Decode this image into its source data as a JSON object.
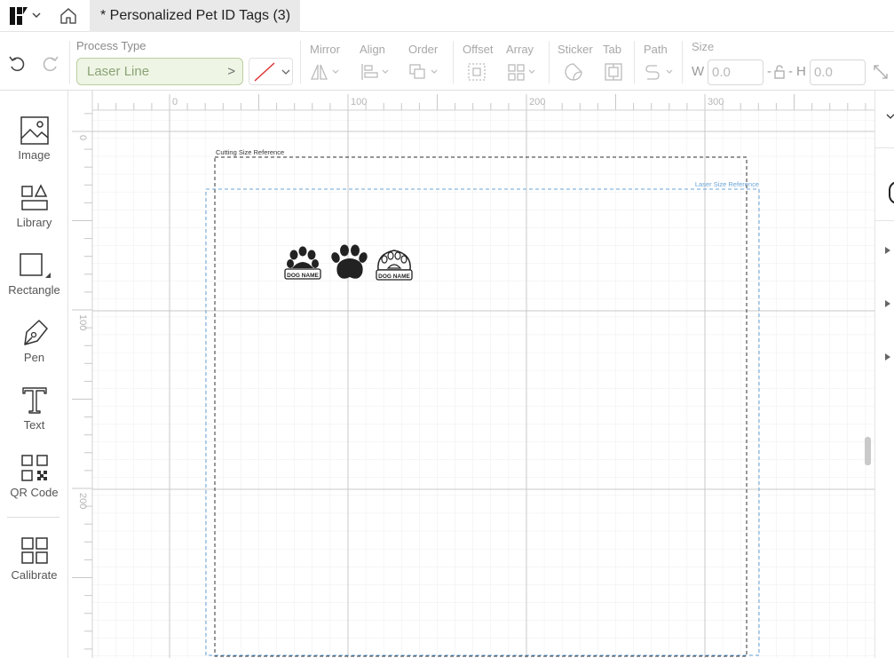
{
  "window": {
    "doc_tab_title": "* Personalized Pet ID Tags (3)"
  },
  "icons": {
    "logo": "app-logo-icon",
    "logo_dropdown": "chevron-down-icon",
    "home": "home-icon",
    "undo": "undo-icon",
    "redo": "redo-icon"
  },
  "toolbar": {
    "process_type_label": "Process Type",
    "process_type_value": "Laser Line",
    "process_type_chevron": ">",
    "groups": {
      "mirror": "Mirror",
      "align": "Align",
      "order": "Order",
      "offset": "Offset",
      "array": "Array",
      "sticker": "Sticker",
      "tab": "Tab",
      "path": "Path",
      "size": "Size"
    },
    "size": {
      "w_label": "W",
      "w_value": "0.0",
      "h_label": "H",
      "h_value": "0.0",
      "dash1": "-",
      "dash2": "-"
    }
  },
  "left_tools": [
    {
      "label": "Image",
      "icon": "image-icon"
    },
    {
      "label": "Library",
      "icon": "library-icon"
    },
    {
      "label": "Rectangle",
      "icon": "rectangle-icon"
    },
    {
      "label": "Pen",
      "icon": "pen-icon"
    },
    {
      "label": "Text",
      "icon": "text-icon"
    },
    {
      "label": "QR Code",
      "icon": "qr-code-icon"
    },
    {
      "label": "Calibrate",
      "icon": "calibrate-icon"
    }
  ],
  "canvas": {
    "ruler_x_labels": [
      "0",
      "100",
      "200",
      "300"
    ],
    "ruler_y_labels": [
      "0",
      "100",
      "200"
    ],
    "cutting_ref_label": "Cutting Size Reference",
    "laser_ref_label": "Laser Size Reference",
    "tag_text": "DOG NAME"
  },
  "colors": {
    "accent_green": "#8aa377",
    "laser_ref": "#5b9bd5",
    "grid_minor": "#ececec",
    "grid_major": "#c8c8c8"
  }
}
